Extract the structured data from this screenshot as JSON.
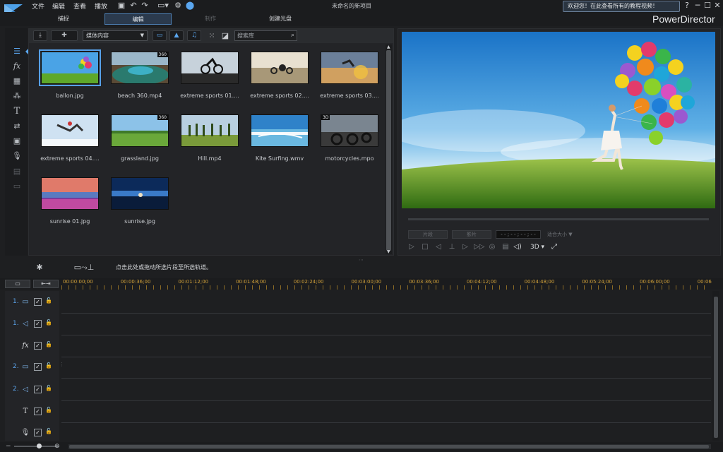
{
  "menu": [
    "文件",
    "编辑",
    "查看",
    "播放"
  ],
  "window_title": "未命名的新项目",
  "welcome_tip": "欢迎您！在此查看所有的教程视频！",
  "brand": "PowerDirector",
  "modes": [
    {
      "label": "捕捉",
      "state": "normal"
    },
    {
      "label": "编辑",
      "state": "active"
    },
    {
      "label": "制作",
      "state": "disabled"
    },
    {
      "label": "创建光盘",
      "state": "normal"
    }
  ],
  "media_toolbar": {
    "dropdown": "媒体内容",
    "search_placeholder": "搜索库"
  },
  "media_items": [
    {
      "name": "ballon.jpg",
      "badge": "",
      "selected": true
    },
    {
      "name": "beach 360.mp4",
      "badge": "360"
    },
    {
      "name": "extreme sports 01....",
      "badge": ""
    },
    {
      "name": "extreme sports 02....",
      "badge": ""
    },
    {
      "name": "extreme sports 03....",
      "badge": ""
    },
    {
      "name": "extreme sports 04....",
      "badge": ""
    },
    {
      "name": "grassland.jpg",
      "badge": "360"
    },
    {
      "name": "Hill.mp4",
      "badge": ""
    },
    {
      "name": "Kite Surfing.wmv",
      "badge": ""
    },
    {
      "name": "motorcycles.mpo",
      "badge": "3D"
    },
    {
      "name": "sunrise 01.jpg",
      "badge": ""
    },
    {
      "name": "sunrise.jpg",
      "badge": ""
    }
  ],
  "preview": {
    "btn_clip": "片段",
    "btn_movie": "影片",
    "timecode": "- - ; - - ; - - ; - -",
    "fit": "适合大小",
    "mode3d": "3D"
  },
  "timeline_hint": "点击此处或拖动所选片段至所选轨道。",
  "ruler": [
    "00:00:00;00",
    "00:00:36;00",
    "00:01:12;00",
    "00:01:48;00",
    "00:02:24;00",
    "00:03:00;00",
    "00:03:36;00",
    "00:04:12;00",
    "00:04:48;00",
    "00:05:24;00",
    "00:06:00;00",
    "00:06"
  ],
  "tracks": [
    {
      "label": "1.",
      "icon": "video-track-icon",
      "glyph": "▭"
    },
    {
      "label": "1.",
      "icon": "audio-track-icon",
      "glyph": "◁"
    },
    {
      "label": "",
      "icon": "fx-track-icon",
      "glyph": "fx"
    },
    {
      "label": "2.",
      "icon": "video-track-icon",
      "glyph": "▭"
    },
    {
      "label": "2.",
      "icon": "audio-track-icon",
      "glyph": "◁"
    },
    {
      "label": "",
      "icon": "title-track-icon",
      "glyph": "T"
    },
    {
      "label": "",
      "icon": "voice-track-icon",
      "glyph": "🎙"
    }
  ],
  "colors": {
    "accent": "#57a0e8",
    "ruler": "#d3a23a"
  }
}
